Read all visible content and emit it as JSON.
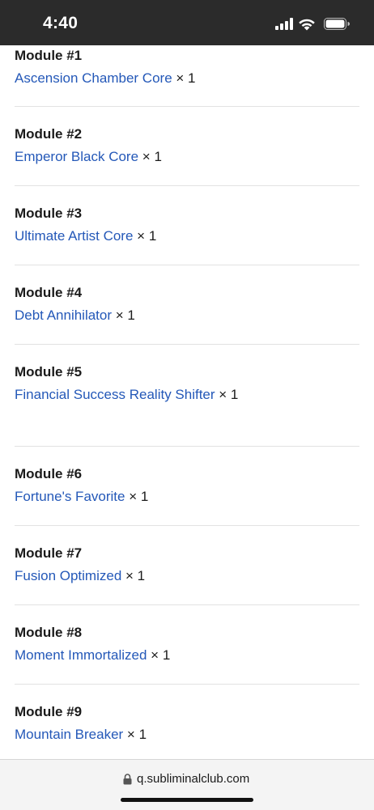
{
  "status_bar": {
    "time": "4:40"
  },
  "modules": [
    {
      "title": "Module #1",
      "link": "Ascension Chamber Core",
      "suffix": "× 1"
    },
    {
      "title": "Module #2",
      "link": "Emperor Black Core",
      "suffix": "× 1"
    },
    {
      "title": "Module #3",
      "link": "Ultimate Artist Core",
      "suffix": "× 1"
    },
    {
      "title": "Module #4",
      "link": "Debt Annihilator",
      "suffix": "× 1"
    },
    {
      "title": "Module #5",
      "link": "Financial Success Reality Shifter",
      "suffix": "× 1"
    },
    {
      "title": "Module #6",
      "link": "Fortune's Favorite",
      "suffix": "× 1"
    },
    {
      "title": "Module #7",
      "link": "Fusion Optimized",
      "suffix": "× 1"
    },
    {
      "title": "Module #8",
      "link": "Moment Immortalized",
      "suffix": "× 1"
    },
    {
      "title": "Module #9",
      "link": "Mountain Breaker",
      "suffix": "× 1"
    }
  ],
  "url_bar": {
    "domain": "q.subliminalclub.com"
  },
  "colors": {
    "status_bar_bg": "#2b2b2b",
    "link": "#2458b8",
    "divider": "#e2e2e2"
  }
}
